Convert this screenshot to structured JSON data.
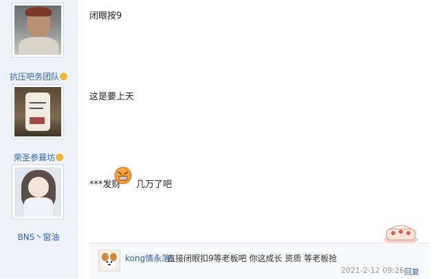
{
  "sidebar": {
    "users": [
      {
        "name": ""
      },
      {
        "name": "抗压吧务团队"
      },
      {
        "name": "荣圣参葺坊"
      },
      {
        "name": "BNS丶窗油"
      }
    ]
  },
  "posts": [
    {
      "text": "闭眼按9"
    },
    {
      "text": "这是要上天"
    },
    {
      "text_before": "***发财",
      "text_after": "几万了吧"
    }
  ],
  "reply": {
    "user": "kong情永落:",
    "text": "直接闭眼扣9等老板吧 你这成长 资质 等老板抢",
    "time": "2021-2-12 09:26",
    "action": "回复"
  },
  "colors": {
    "link": "#2d64b3",
    "sidebar_bg": "#eef2f8"
  },
  "icons": [
    "angry-face-emoji-icon",
    "medal-icon",
    "decorative-cake-icon"
  ]
}
